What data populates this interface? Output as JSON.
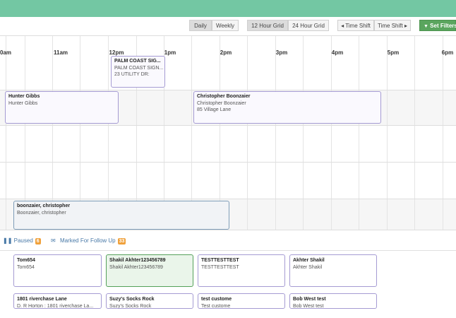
{
  "toolbar": {
    "daily": "Daily",
    "weekly": "Weekly",
    "grid12": "12 Hour Grid",
    "grid24": "24 Hour Grid",
    "shift_back": "◂ Time Shift",
    "shift_fwd": "Time Shift ▸",
    "set_filters": "Set Filters"
  },
  "hours": [
    "0am",
    "11am",
    "12pm",
    "1pm",
    "2pm",
    "3pm",
    "4pm",
    "5pm",
    "6pm"
  ],
  "events": {
    "e1": {
      "title": "PALM COAST SIG...",
      "line1": "PALM COAST SIGN...",
      "line2": "23 UTILITY DR:"
    },
    "e2": {
      "title": "Hunter Gibbs",
      "line1": "Hunter Gibbs"
    },
    "e3": {
      "title": "Christopher Boonzaier",
      "line1": "Christopher Boonzaier",
      "line2": "85 Village Lane"
    },
    "e4": {
      "title": "boonzaier, christopher",
      "line1": "Boonzaier, christopher"
    }
  },
  "status": {
    "paused_label": "Paused",
    "paused_count": "6",
    "followup_label": "Marked For Follow Up",
    "followup_count": "33"
  },
  "cards": {
    "c1": {
      "title": "Tom654",
      "line1": "Tom654"
    },
    "c2": {
      "title": "Shakil Akhter123456789",
      "line1": "Shakil Akhter123456789"
    },
    "c3": {
      "title": "TESTTESTTEST",
      "line1": "TESTTESTTEST"
    },
    "c4": {
      "title": "Akhter Shakil",
      "line1": "Akhter Shakil"
    },
    "c5": {
      "title": "1801 riverchase Lane",
      "line1": "D. R Horton : 1801 riverchase La..."
    },
    "c6": {
      "title": "Suzy's Socks Rock",
      "line1": "Suzy's Socks Rock"
    },
    "c7": {
      "title": "test custome",
      "line1": "Test custome"
    },
    "c8": {
      "title": "Bob West test",
      "line1": "Bob West test"
    }
  },
  "colors": {
    "header_bar": "#73c7a3",
    "accent_green": "#5aa55e",
    "badge_orange": "#f0a13b",
    "link_blue": "#4a7aa8"
  }
}
